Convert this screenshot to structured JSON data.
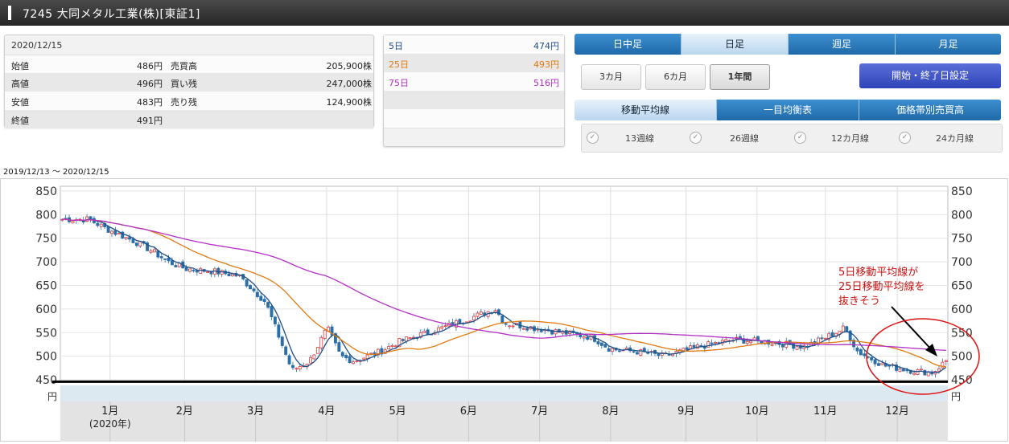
{
  "header": {
    "title": "7245 大同メタル工業(株)[東証1]"
  },
  "quote": {
    "date": "2020/12/15",
    "rows": [
      {
        "l1": "始値",
        "v1": "486円",
        "l2": "売買高",
        "v2": "205,900株"
      },
      {
        "l1": "高値",
        "v1": "496円",
        "l2": "買い残",
        "v2": "247,000株"
      },
      {
        "l1": "安値",
        "v1": "483円",
        "l2": "売り残",
        "v2": "124,900株"
      },
      {
        "l1": "終値",
        "v1": "491円",
        "l2": "",
        "v2": ""
      }
    ]
  },
  "ma_panel": {
    "rows": [
      {
        "label": "5日",
        "value": "474円",
        "color": "#1d4e89"
      },
      {
        "label": "25日",
        "value": "493円",
        "color": "#e07a10"
      },
      {
        "label": "75日",
        "value": "516円",
        "color": "#b22fc5"
      }
    ]
  },
  "tabs": {
    "daily_intraday": "日中足",
    "daily": "日足",
    "weekly": "週足",
    "monthly": "月足"
  },
  "periods": {
    "m3": "3カ月",
    "m6": "6カ月",
    "y1": "1年間"
  },
  "date_setting_button": "開始・終了日設定",
  "tabs2": {
    "moving_avg": "移動平均線",
    "ichimoku": "一目均衡表",
    "volume_by_price": "価格帯別売買高"
  },
  "week_lines": {
    "w13": "13週線",
    "w26": "26週線",
    "m12": "12カ月線",
    "m24": "24カ月線"
  },
  "date_range": "2019/12/13 〜 2020/12/15",
  "chart_data": {
    "type": "candlestick",
    "ylim": [
      445,
      860
    ],
    "y_ticks": [
      450,
      500,
      550,
      600,
      650,
      700,
      750,
      800,
      850
    ],
    "y_unit_left": "円",
    "y_unit_right": "円",
    "x_labels": [
      {
        "label": "1月",
        "sub": "(2020年)",
        "t": 0.056
      },
      {
        "label": "2月",
        "t": 0.14
      },
      {
        "label": "3月",
        "t": 0.22
      },
      {
        "label": "4月",
        "t": 0.3
      },
      {
        "label": "5月",
        "t": 0.38
      },
      {
        "label": "6月",
        "t": 0.46
      },
      {
        "label": "7月",
        "t": 0.54
      },
      {
        "label": "8月",
        "t": 0.62
      },
      {
        "label": "9月",
        "t": 0.705
      },
      {
        "label": "10月",
        "t": 0.785
      },
      {
        "label": "11月",
        "t": 0.862
      },
      {
        "label": "12月",
        "t": 0.943
      }
    ],
    "close_anchors": [
      [
        0,
        790
      ],
      [
        0.03,
        790
      ],
      [
        0.05,
        770
      ],
      [
        0.08,
        745
      ],
      [
        0.1,
        725
      ],
      [
        0.12,
        700
      ],
      [
        0.14,
        685
      ],
      [
        0.17,
        680
      ],
      [
        0.2,
        670
      ],
      [
        0.23,
        615
      ],
      [
        0.26,
        470
      ],
      [
        0.28,
        490
      ],
      [
        0.3,
        560
      ],
      [
        0.315,
        500
      ],
      [
        0.33,
        490
      ],
      [
        0.36,
        510
      ],
      [
        0.38,
        530
      ],
      [
        0.43,
        560
      ],
      [
        0.46,
        580
      ],
      [
        0.49,
        600
      ],
      [
        0.5,
        570
      ],
      [
        0.55,
        555
      ],
      [
        0.6,
        540
      ],
      [
        0.62,
        515
      ],
      [
        0.65,
        510
      ],
      [
        0.68,
        500
      ],
      [
        0.72,
        520
      ],
      [
        0.76,
        535
      ],
      [
        0.8,
        530
      ],
      [
        0.84,
        520
      ],
      [
        0.87,
        545
      ],
      [
        0.885,
        560
      ],
      [
        0.9,
        510
      ],
      [
        0.93,
        480
      ],
      [
        0.96,
        470
      ],
      [
        0.985,
        465
      ],
      [
        1.0,
        491
      ]
    ],
    "series": [
      {
        "name": "5日",
        "color": "#1d4e89",
        "period": 5
      },
      {
        "name": "25日",
        "color": "#e07a10",
        "period": 25
      },
      {
        "name": "75日",
        "color": "#b22fc5",
        "period": 75
      }
    ],
    "support_line": 446,
    "annotation": {
      "lines": [
        "5日移動平均線が",
        "25日移動平均線を",
        "抜きそう"
      ],
      "color": "#cc1111"
    }
  }
}
